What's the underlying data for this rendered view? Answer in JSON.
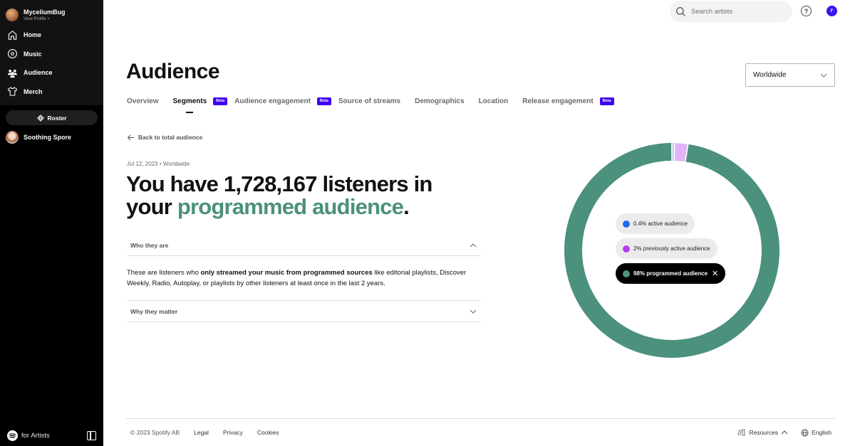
{
  "sidebar": {
    "profile": {
      "name": "MyceliumBug",
      "link": "View Profile >"
    },
    "nav": [
      {
        "label": "Home",
        "icon": "home-icon"
      },
      {
        "label": "Music",
        "icon": "music-disc-icon"
      },
      {
        "label": "Audience",
        "icon": "audience-icon"
      },
      {
        "label": "Merch",
        "icon": "shirt-icon"
      }
    ],
    "roster_label": "Roster",
    "artist": "Soothing Spore",
    "brand_label": "for Artists"
  },
  "topbar": {
    "search_placeholder": "Search artists",
    "help_label": "?",
    "user_initial": "F"
  },
  "header": {
    "title": "Audience",
    "region": "Worldwide",
    "tabs": [
      {
        "label": "Overview",
        "active": false,
        "beta": false
      },
      {
        "label": "Segments",
        "active": true,
        "beta": true
      },
      {
        "label": "Audience engagement",
        "active": false,
        "beta": true
      },
      {
        "label": "Source of streams",
        "active": false,
        "beta": false
      },
      {
        "label": "Demographics",
        "active": false,
        "beta": false
      },
      {
        "label": "Location",
        "active": false,
        "beta": false
      },
      {
        "label": "Release engagement",
        "active": false,
        "beta": true
      }
    ],
    "beta_label": "Beta"
  },
  "content": {
    "back_label": "Back to total audience",
    "meta": "Jul 12, 2023 • Worldwide",
    "headline_prefix": "You have 1,728,167 listeners in your",
    "headline_accent": "programmed audience",
    "headline_suffix": ".",
    "accordion": [
      {
        "title": "Who they are",
        "expanded": true,
        "body_before": "These are listeners who ",
        "body_bold": "only streamed your music from programmed sources",
        "body_after": " like editorial playlists, Discover Weekly, Radio, Autoplay, or playlists by other listeners at least once in the last 2 years."
      },
      {
        "title": "Why they matter",
        "expanded": false
      }
    ]
  },
  "chart_data": {
    "type": "pie",
    "variant": "donut",
    "title": "",
    "selected": "programmed audience",
    "series": [
      {
        "name": "active audience",
        "label": "0.4% active audience",
        "value": 0.4,
        "color": "#1e6bf0",
        "ring_color": "#a9c4ec"
      },
      {
        "name": "previously active audience",
        "label": "2% previously active audience",
        "value": 2,
        "color": "#b73cf0",
        "ring_color": "#e2b3f6"
      },
      {
        "name": "programmed audience",
        "label": "98% programmed audience",
        "value": 98,
        "color": "#4b917d",
        "ring_color": "#4b917d"
      }
    ]
  },
  "footer": {
    "copyright": "© 2023 Spotify AB",
    "links": [
      "Legal",
      "Privacy",
      "Cookies"
    ],
    "resources": "Resources",
    "language": "English"
  }
}
